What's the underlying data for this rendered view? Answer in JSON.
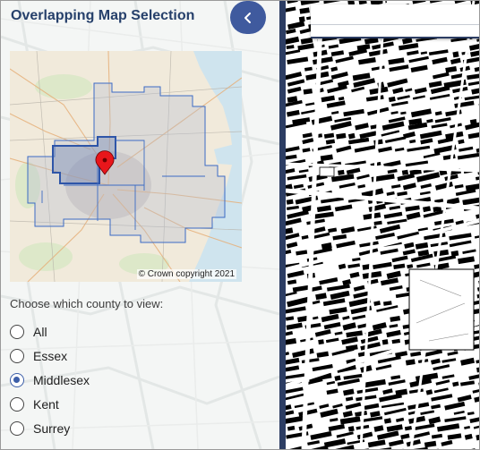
{
  "panel": {
    "title": "Overlapping Map Selection",
    "collapse_button_icon": "chevron-left-icon"
  },
  "thumbnail": {
    "copyright": "© Crown copyright 2021"
  },
  "county_selector": {
    "prompt": "Choose which county to view:",
    "options": [
      {
        "label": "All",
        "checked": false
      },
      {
        "label": "Essex",
        "checked": false
      },
      {
        "label": "Middlesex",
        "checked": true
      },
      {
        "label": "Kent",
        "checked": false
      },
      {
        "label": "Surrey",
        "checked": false
      }
    ]
  },
  "colors": {
    "title": "#26406b",
    "accent": "#3f5a9e",
    "divider": "#2c3d63",
    "boundary": "#3b6bc4",
    "marker": "#e8161b"
  }
}
